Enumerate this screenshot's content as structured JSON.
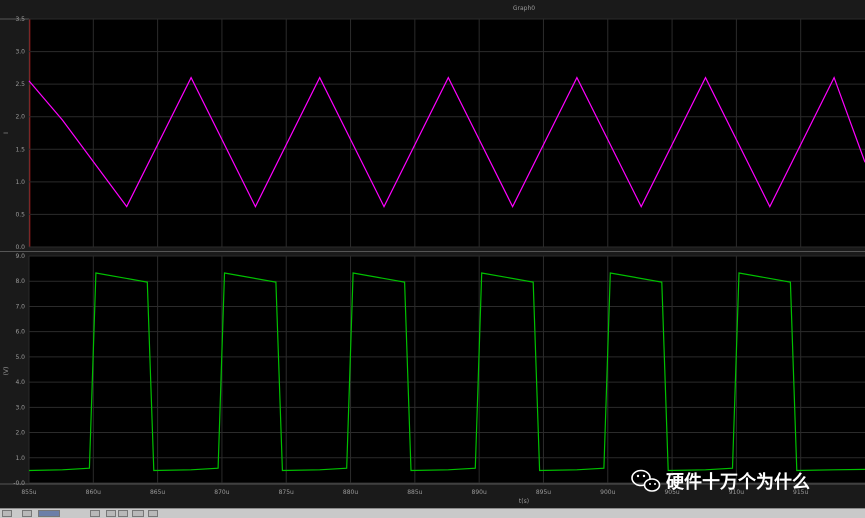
{
  "graph": {
    "title": "Graph0",
    "x_axis_label": "t(s)",
    "background": "#000000",
    "grid_color": "#2b2b2b"
  },
  "watermark": {
    "text": "硬件十万个为什么",
    "icon": "wechat-icon"
  },
  "chart_data": [
    {
      "type": "line",
      "panel": "top",
      "ylabel": "I",
      "y_ticks": [
        "0.0",
        "0.5",
        "1.0",
        "1.5",
        "2.0",
        "2.5",
        "3.0",
        "3.5"
      ],
      "ylim": [
        0,
        3.5
      ],
      "xlim": [
        855,
        920
      ],
      "x_ticks": [
        "855u",
        "860u",
        "865u",
        "870u",
        "875u",
        "880u",
        "885u",
        "890u",
        "895u",
        "900u",
        "905u",
        "910u",
        "915u"
      ],
      "series": [
        {
          "color": "#ff00ff",
          "x": [
            855,
            857.6,
            862.6,
            867.6,
            872.6,
            877.6,
            882.6,
            887.6,
            892.6,
            897.6,
            902.6,
            907.6,
            912.6,
            917.6,
            920
          ],
          "y": [
            2.55,
            1.95,
            0.62,
            2.6,
            0.62,
            2.6,
            0.62,
            2.6,
            0.62,
            2.6,
            0.62,
            2.6,
            0.62,
            2.6,
            1.3
          ]
        }
      ]
    },
    {
      "type": "line",
      "panel": "bottom",
      "ylabel": "(V)",
      "y_ticks": [
        "-0.0",
        "1.0",
        "2.0",
        "3.0",
        "4.0",
        "5.0",
        "6.0",
        "7.0",
        "8.0",
        "9.0"
      ],
      "ylim": [
        -1.0,
        9.0
      ],
      "xlim": [
        855,
        920
      ],
      "x_ticks": [
        "855u",
        "860u",
        "865u",
        "870u",
        "875u",
        "880u",
        "885u",
        "890u",
        "895u",
        "900u",
        "905u",
        "910u",
        "915u"
      ],
      "series": [
        {
          "color": "#00c000",
          "x": [
            855,
            857.6,
            859.7,
            860.2,
            864.2,
            864.7,
            867.6,
            869.7,
            870.2,
            874.2,
            874.7,
            877.6,
            879.7,
            880.2,
            884.2,
            884.7,
            887.6,
            889.7,
            890.2,
            894.2,
            894.7,
            897.6,
            899.7,
            900.2,
            904.2,
            904.7,
            907.6,
            909.7,
            910.2,
            914.2,
            914.7,
            917.6,
            920
          ],
          "y": [
            -0.45,
            -0.42,
            -0.35,
            8.25,
            7.85,
            -0.45,
            -0.42,
            -0.35,
            8.25,
            7.85,
            -0.45,
            -0.42,
            -0.35,
            8.25,
            7.85,
            -0.45,
            -0.42,
            -0.35,
            8.25,
            7.85,
            -0.45,
            -0.42,
            -0.35,
            8.25,
            7.85,
            -0.45,
            -0.42,
            -0.35,
            8.25,
            7.85,
            -0.45,
            -0.42,
            -0.4
          ]
        }
      ]
    }
  ]
}
